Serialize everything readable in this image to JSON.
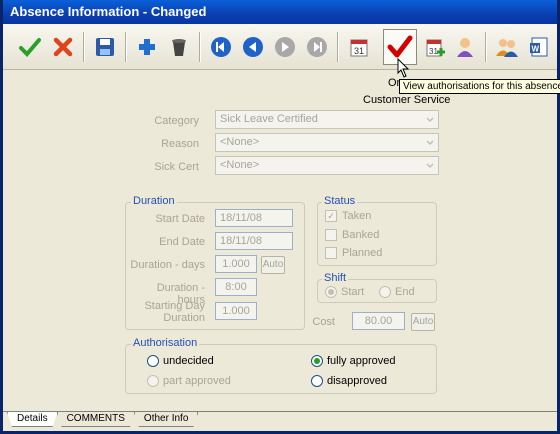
{
  "window": {
    "title": "Absence Information - Changed"
  },
  "toolbar": {
    "buttons": [
      {
        "icon": "checkmark-icon",
        "color": "#2aa02a"
      },
      {
        "icon": "delete-x-icon",
        "color": "#e0441c"
      },
      {
        "icon": "save-disk-icon",
        "color": "#2a5aa8"
      },
      {
        "icon": "add-plus-icon",
        "color": "#1f6fd0"
      },
      {
        "icon": "trash-bin-icon",
        "color": "#444444"
      },
      {
        "icon": "first-record-icon",
        "color": "#1f62c8"
      },
      {
        "icon": "previous-record-icon",
        "color": "#1f62c8"
      },
      {
        "icon": "next-record-icon",
        "color": "#a0a0a0"
      },
      {
        "icon": "last-record-icon",
        "color": "#a0a0a0"
      },
      {
        "icon": "calendar-icon",
        "color": "#c83030"
      },
      {
        "icon": "authorisation-tick-icon",
        "color": "#d40000"
      },
      {
        "icon": "calendar-add-icon",
        "color": "#2a9a2a"
      },
      {
        "icon": "person-icon",
        "color": "#8050c0"
      },
      {
        "icon": "people-icon",
        "color": "#d89020"
      },
      {
        "icon": "word-document-icon",
        "color": "#2a5aa8"
      }
    ],
    "ghost_text_1": "On",
    "ghost_text_2": "Customer Service"
  },
  "tooltip": {
    "text": "View authorisations for this absence"
  },
  "form": {
    "category_label": "Category",
    "category_value": "Sick Leave Certified",
    "reason_label": "Reason",
    "reason_value": "<None>",
    "sickcert_label": "Sick Cert",
    "sickcert_value": "<None>"
  },
  "duration": {
    "title": "Duration",
    "start_label": "Start Date",
    "start_value": "18/11/08",
    "end_label": "End Date",
    "end_value": "18/11/08",
    "days_label": "Duration - days",
    "days_value": "1.000",
    "days_btn": "Auto",
    "hours_label": "Duration - hours",
    "hours_value": "8:00",
    "startday_label_1": "Starting Day",
    "startday_label_2": "Duration",
    "startday_value": "1.000"
  },
  "status": {
    "title": "Status",
    "taken": "Taken",
    "banked": "Banked",
    "planned": "Planned"
  },
  "shift": {
    "title": "Shift",
    "start": "Start",
    "end": "End"
  },
  "cost": {
    "label": "Cost",
    "value": "80.00",
    "btn": "Auto"
  },
  "authorisation": {
    "title": "Authorisation",
    "undecided": "undecided",
    "part_approved": "part approved",
    "fully_approved": "fully approved",
    "disapproved": "disapproved"
  },
  "tabs": [
    "Details",
    "COMMENTS",
    "Other Info"
  ]
}
